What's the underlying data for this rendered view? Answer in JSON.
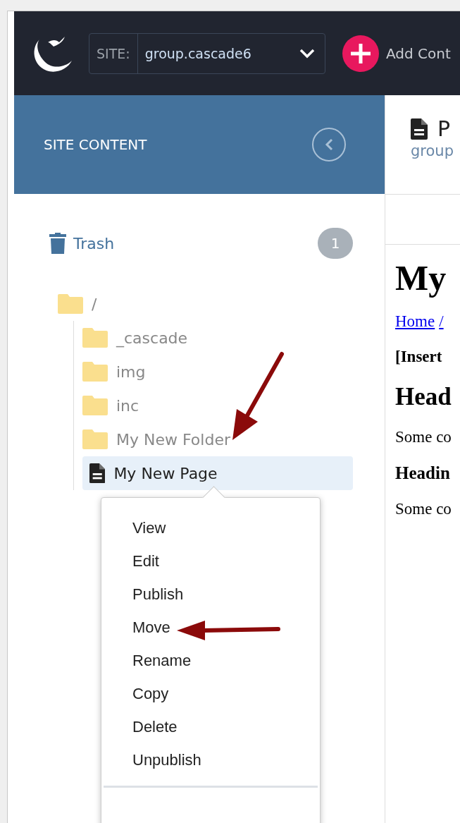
{
  "topbar": {
    "site_label": "SITE:",
    "site_value": "group.cascade6",
    "add_label": "Add Cont"
  },
  "sidebar": {
    "title": "SITE CONTENT",
    "trash": {
      "label": "Trash",
      "count": "1"
    },
    "tree": [
      {
        "label": "/",
        "kind": "folder",
        "selected": false,
        "children": [
          {
            "label": "_cascade",
            "kind": "folder",
            "selected": false
          },
          {
            "label": "img",
            "kind": "folder",
            "selected": false
          },
          {
            "label": "inc",
            "kind": "folder",
            "selected": false
          },
          {
            "label": "My New Folder",
            "kind": "folder",
            "selected": false
          },
          {
            "label": "My New Page",
            "kind": "page",
            "selected": true
          }
        ]
      }
    ]
  },
  "context_menu": {
    "items": [
      "View",
      "Edit",
      "Publish",
      "Move",
      "Rename",
      "Copy",
      "Delete",
      "Unpublish"
    ]
  },
  "main": {
    "title": "P",
    "subtitle": "group",
    "heading": "My",
    "breadcrumb": [
      "Home",
      "/"
    ],
    "blocks": [
      {
        "kind": "strong",
        "text": "[Insert"
      },
      {
        "kind": "h2",
        "text": "Head"
      },
      {
        "kind": "p",
        "text": "Some co"
      },
      {
        "kind": "h3",
        "text": "Headin"
      },
      {
        "kind": "p",
        "text": "Some co"
      }
    ]
  }
}
